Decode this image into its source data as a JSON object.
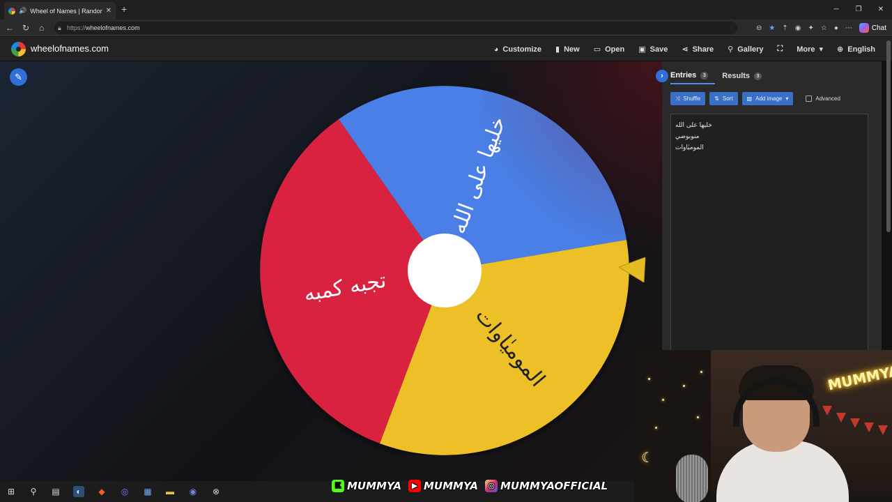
{
  "browser": {
    "tab_title": "Wheel of Names | Random na",
    "url_proto": "https://",
    "url_host": "wheelofnames.com",
    "chat_label": "Chat"
  },
  "header": {
    "brand": "wheelofnames.com",
    "menu": [
      {
        "label": "Customize",
        "icon": "palette-icon"
      },
      {
        "label": "New",
        "icon": "file-icon"
      },
      {
        "label": "Open",
        "icon": "folder-icon"
      },
      {
        "label": "Save",
        "icon": "save-icon"
      },
      {
        "label": "Share",
        "icon": "share-icon"
      },
      {
        "label": "Gallery",
        "icon": "search-icon"
      },
      {
        "label": "",
        "icon": "fullscreen-icon"
      },
      {
        "label": "More",
        "icon": "chevron-down-icon"
      },
      {
        "label": "English",
        "icon": "globe-icon"
      }
    ]
  },
  "panel": {
    "tabs": [
      {
        "label": "Entries",
        "count": "3"
      },
      {
        "label": "Results",
        "count": "3"
      }
    ],
    "buttons": {
      "shuffle": "Shuffle",
      "sort": "Sort",
      "add_image": "Add image",
      "advanced": "Advanced"
    },
    "entries": [
      "خليها على الله",
      "منوبوضي",
      "الموميٰاوات"
    ]
  },
  "wheel": {
    "segments": [
      {
        "label": "خليها على الله",
        "color": "#4a7fe6"
      },
      {
        "label": "الموميٰاوات",
        "color": "#ecc025"
      },
      {
        "label": "تجبه كمبه",
        "color": "#d8223f"
      }
    ]
  },
  "overlay": {
    "socials": [
      {
        "platform": "kick",
        "handle": "MUMMYA",
        "color": "#53fc18"
      },
      {
        "platform": "youtube",
        "handle": "MUMMYA",
        "color": "#ff0000"
      },
      {
        "platform": "instagram",
        "handle": "MUMMYAOFFICIAL",
        "color": "#d62976"
      }
    ],
    "neon_sign": "MUMMYA"
  }
}
